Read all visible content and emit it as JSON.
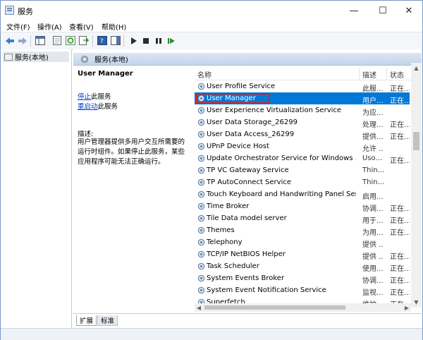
{
  "window": {
    "title": "服务",
    "minimize": "—",
    "maximize": "☐",
    "close": "✕"
  },
  "menu": [
    "文件(F)",
    "操作(A)",
    "查看(V)",
    "帮助(H)"
  ],
  "tree": {
    "root": "服务(本地)"
  },
  "main": {
    "header": "服务(本地)"
  },
  "desc": {
    "title": "User Manager",
    "stop_link": "停止",
    "stop_suffix": "此服务",
    "restart_link": "重启动",
    "restart_suffix": "此服务",
    "label": "描述:",
    "text": "用户管理器提供多用户交互所需要的运行时组件。如果停止此服务，某些应用程序可能无法正确运行。"
  },
  "list": {
    "columns": {
      "name": "名称",
      "desc": "描述",
      "status": "状态"
    },
    "rows": [
      {
        "name": "User Profile Service",
        "desc": "此服...",
        "status": "正在..."
      },
      {
        "name": "User Manager",
        "desc": "用户...",
        "status": "正在..."
      },
      {
        "name": "User Experience Virtualization Service",
        "desc": "为应...",
        "status": ""
      },
      {
        "name": "User Data Storage_26299",
        "desc": "处理...",
        "status": "正在..."
      },
      {
        "name": "User Data Access_26299",
        "desc": "提供...",
        "status": "正在..."
      },
      {
        "name": "UPnP Device Host",
        "desc": "允许 ...",
        "status": ""
      },
      {
        "name": "Update Orchestrator Service for Windows ...",
        "desc": "Usо...",
        "status": "正在..."
      },
      {
        "name": "TP VC Gateway Service",
        "desc": "Thin...",
        "status": ""
      },
      {
        "name": "TP AutoConnect Service",
        "desc": "Thin...",
        "status": ""
      },
      {
        "name": "Touch Keyboard and Handwriting Panel Ser...",
        "desc": "启用...",
        "status": ""
      },
      {
        "name": "Time Broker",
        "desc": "协调...",
        "status": "正在..."
      },
      {
        "name": "Tile Data model server",
        "desc": "用于...",
        "status": "正在..."
      },
      {
        "name": "Themes",
        "desc": "为用...",
        "status": "正在..."
      },
      {
        "name": "Telephony",
        "desc": "提供 ...",
        "status": ""
      },
      {
        "name": "TCP/IP NetBIOS Helper",
        "desc": "提供 ...",
        "status": "正在..."
      },
      {
        "name": "Task Scheduler",
        "desc": "使用...",
        "status": "正在..."
      },
      {
        "name": "System Events Broker",
        "desc": "协调...",
        "status": "正在..."
      },
      {
        "name": "System Event Notification Service",
        "desc": "监视...",
        "status": "正在..."
      },
      {
        "name": "Superfetch",
        "desc": "维护...",
        "status": "正在..."
      }
    ],
    "selected_row": "User Manager"
  },
  "tabs": [
    "扩展",
    "标准"
  ],
  "colors": {
    "selection": "#0078d7",
    "highlight_box": "#e02020",
    "link": "#0044cc"
  }
}
